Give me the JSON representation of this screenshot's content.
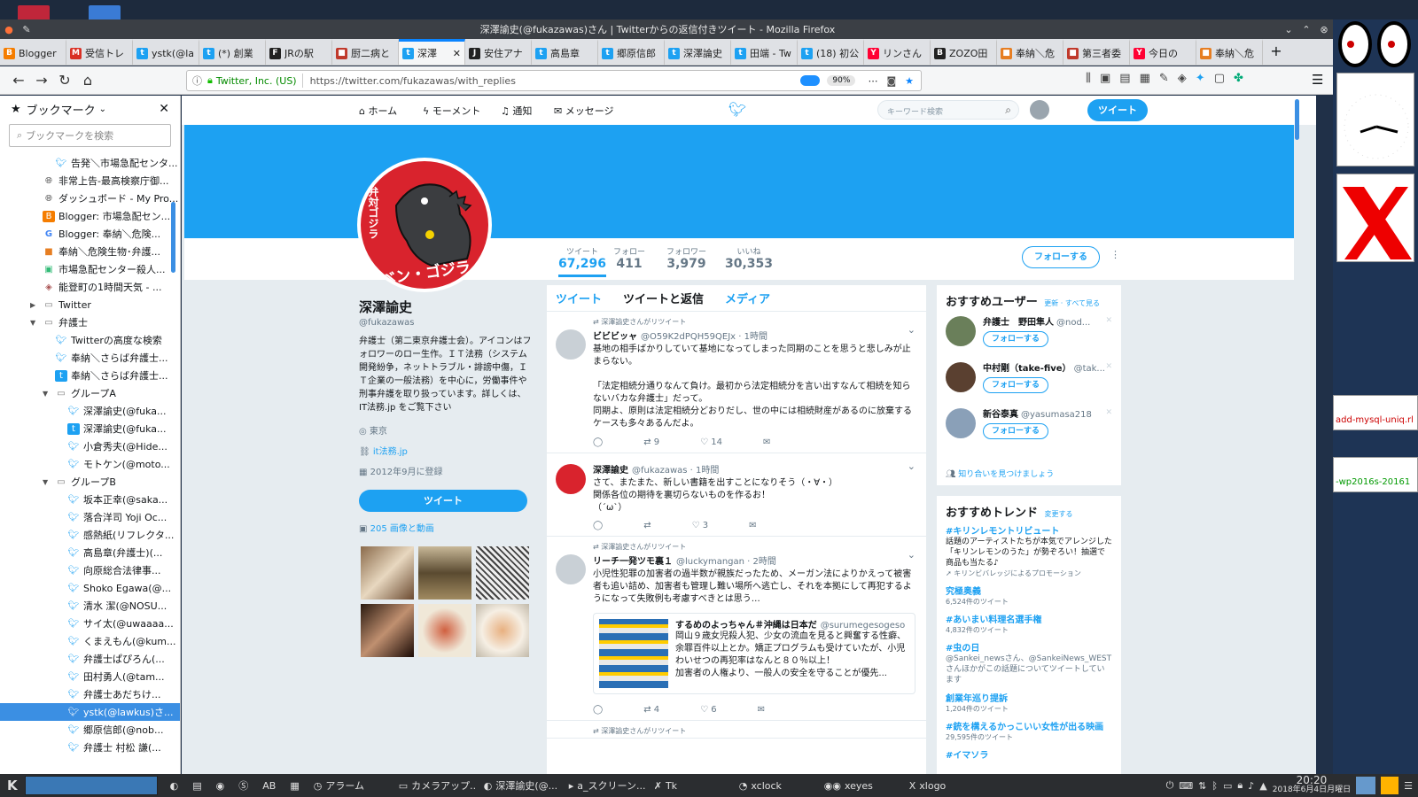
{
  "window_title": "深澤諭史(@fukazawas)さん | Twitterからの返信付きツイート - Mozilla Firefox",
  "tabs": [
    {
      "label": "Blogger",
      "color": "#f57d00",
      "glyph": "B"
    },
    {
      "label": "受信トレ",
      "color": "#d93025",
      "glyph": "M"
    },
    {
      "label": "ystk(@la",
      "color": "#1da1f2",
      "glyph": "t"
    },
    {
      "label": "(*) 創業",
      "color": "#1da1f2",
      "glyph": "t"
    },
    {
      "label": "JRの駅",
      "color": "#222222",
      "glyph": "F"
    },
    {
      "label": "厨二病と",
      "color": "#c0392b",
      "glyph": "■"
    },
    {
      "label": "深澤",
      "color": "#1da1f2",
      "glyph": "t",
      "active": true
    },
    {
      "label": "安住アナ",
      "color": "#222222",
      "glyph": "J"
    },
    {
      "label": "高島章",
      "color": "#1da1f2",
      "glyph": "t"
    },
    {
      "label": "郷原信郎",
      "color": "#1da1f2",
      "glyph": "t"
    },
    {
      "label": "深澤論史",
      "color": "#1da1f2",
      "glyph": "t"
    },
    {
      "label": "田端 - Tw",
      "color": "#1da1f2",
      "glyph": "t"
    },
    {
      "label": "(18) 初公",
      "color": "#1da1f2",
      "glyph": "t"
    },
    {
      "label": "リンさん",
      "color": "#ff0033",
      "glyph": "Y"
    },
    {
      "label": "ZOZO田",
      "color": "#222222",
      "glyph": "B"
    },
    {
      "label": "奉納＼危",
      "color": "#e67e22",
      "glyph": "■"
    },
    {
      "label": "第三者委",
      "color": "#c0392b",
      "glyph": "■"
    },
    {
      "label": "今日の",
      "color": "#ff0033",
      "glyph": "Y"
    },
    {
      "label": "奉納＼危",
      "color": "#e67e22",
      "glyph": "■"
    }
  ],
  "urlbar": {
    "identity": "Twitter, Inc. (US)",
    "url": "https://twitter.com/fukazawas/with_replies",
    "zoom": "90%"
  },
  "sidebar": {
    "title": "ブックマーク",
    "search_placeholder": "ブックマークを検索",
    "items": [
      {
        "label": "告発＼市場急配センタ...",
        "indent": 62,
        "icon": "tw"
      },
      {
        "label": "非常上告-最高検察庁御...",
        "indent": 48,
        "icon": "globe"
      },
      {
        "label": "ダッシュボード - My Pro...",
        "indent": 48,
        "icon": "globe"
      },
      {
        "label": "Blogger: 市場急配セン...",
        "indent": 48,
        "icon": "blogger"
      },
      {
        "label": "Blogger: 奉納＼危険...",
        "indent": 48,
        "icon": "g"
      },
      {
        "label": "奉納＼危険生物･弁護...",
        "indent": 48,
        "icon": "red"
      },
      {
        "label": "市場急配センター殺人...",
        "indent": 48,
        "icon": "img"
      },
      {
        "label": "能登町の1時間天気 - ...",
        "indent": 48,
        "icon": "cube"
      },
      {
        "label": "Twitter",
        "indent": 48,
        "icon": "folder",
        "arrow": "▶"
      },
      {
        "label": "弁護士",
        "indent": 48,
        "icon": "folder",
        "arrow": "▼"
      },
      {
        "label": "Twitterの高度な検索",
        "indent": 62,
        "icon": "tw"
      },
      {
        "label": "奉納＼さらば弁護士...",
        "indent": 62,
        "icon": "tw"
      },
      {
        "label": "奉納＼さらば弁護士...",
        "indent": 62,
        "icon": "tsq"
      },
      {
        "label": "グループA",
        "indent": 62,
        "icon": "folder",
        "arrow": "▼"
      },
      {
        "label": "深澤諭史(@fuka...",
        "indent": 76,
        "icon": "tw"
      },
      {
        "label": "深澤諭史(@fuka...",
        "indent": 76,
        "icon": "tsq"
      },
      {
        "label": "小倉秀夫(@Hide...",
        "indent": 76,
        "icon": "tw"
      },
      {
        "label": "モトケン(@moto...",
        "indent": 76,
        "icon": "tw"
      },
      {
        "label": "グループB",
        "indent": 62,
        "icon": "folder",
        "arrow": "▼"
      },
      {
        "label": "坂本正幸(@saka...",
        "indent": 76,
        "icon": "tw"
      },
      {
        "label": "落合洋司 Yoji Oc...",
        "indent": 76,
        "icon": "tw"
      },
      {
        "label": "感熱紙(リフレクタ...",
        "indent": 76,
        "icon": "tw"
      },
      {
        "label": "高島章(弁護士)(...",
        "indent": 76,
        "icon": "tw"
      },
      {
        "label": "向原総合法律事...",
        "indent": 76,
        "icon": "tw"
      },
      {
        "label": "Shoko Egawa(@...",
        "indent": 76,
        "icon": "tw"
      },
      {
        "label": "清水 潔(@NOSU...",
        "indent": 76,
        "icon": "tw"
      },
      {
        "label": "サイ太(@uwaaaa...",
        "indent": 76,
        "icon": "tw"
      },
      {
        "label": "くまえもん(@kum...",
        "indent": 76,
        "icon": "tw"
      },
      {
        "label": "弁護士ぱぴろん(...",
        "indent": 76,
        "icon": "tw"
      },
      {
        "label": "田村勇人(@tam...",
        "indent": 76,
        "icon": "tw"
      },
      {
        "label": "弁護士あだちけ...",
        "indent": 76,
        "icon": "tw"
      },
      {
        "label": "ystk(@lawkus)さ...",
        "indent": 76,
        "icon": "tw",
        "selected": true
      },
      {
        "label": "郷原信郎(@nob...",
        "indent": 76,
        "icon": "tw"
      },
      {
        "label": "弁護士 村松 謙(...",
        "indent": 76,
        "icon": "tw"
      }
    ]
  },
  "twitter": {
    "nav": {
      "home": "ホーム",
      "moments": "モーメント",
      "notifications": "通知",
      "messages": "メッセージ",
      "search_placeholder": "キーワード検索",
      "tweet_button": "ツイート"
    },
    "stats": [
      {
        "key": "ツイート",
        "value": "67,296",
        "active": true
      },
      {
        "key": "フォロー",
        "value": "411"
      },
      {
        "key": "フォロワー",
        "value": "3,979"
      },
      {
        "key": "いいね",
        "value": "30,353"
      }
    ],
    "follow_button": "フォローする",
    "avatar_text_1": "弁対ゴジラ",
    "avatar_text_2": "ベン・ゴジラ",
    "profile": {
      "name": "深澤諭史",
      "handle": "@fukazawas",
      "bio": "弁護士（第二東京弁護士会）。アイコンはフォロワーのロー生作。ＩＴ法務（システム開発紛争，ネットトラブル・誹謗中傷，ＩＴ企業の一般法務）を中心に，労働事件や刑事弁護を取り扱っています。詳しくは、IT法務.jp をご覧下さい",
      "location": "東京",
      "website": "it法務.jp",
      "joined": "2012年9月に登録",
      "tweet_button": "ツイート",
      "media_label": "205 画像と動画"
    },
    "timeline_tabs": [
      "ツイート",
      "ツイートと返信",
      "メディア"
    ],
    "tweets": [
      {
        "context": "深澤諭史さんがリツイート",
        "name": "ビビビッャ",
        "handle": "@O59K2dPQH59QEJx",
        "time": "1時間",
        "text": "基地の相手ばかりしていて基地になってしまった同期のことを思うと悲しみが止まらない。\n\n「法定相続分通りなんて負け。最初から法定相続分を言い出すなんて相続を知らないバカな弁護士」だって。\n同期よ、原則は法定相続分どおりだし、世の中には相続財産があるのに放棄するケースも多々あるんだよ。",
        "retweets": "9",
        "likes": "14"
      },
      {
        "context": "",
        "name": "深澤諭史",
        "handle": "@fukazawas",
        "time": "1時間",
        "text": "さて、またまた、新しい書籍を出すことになりそう（・∀・）\n関係各位の期待を裏切らないものを作るお！\n（´ω`）",
        "retweets": "",
        "likes": "3"
      },
      {
        "context": "深澤諭史さんがリツイート",
        "name": "リーチ一発ツモ裏１",
        "handle": "@luckymangan",
        "time": "2時間",
        "text": "小児性犯罪の加害者の過半数が親族だったため、メーガン法によりかえって被害者も追い詰め、加害者も管理し難い場所へ逃亡し、それを本拠にして再犯するようになって失敗例も考慮すべきとは思う…",
        "quote_name": "するめのよっちゃん＃沖縄は日本だ",
        "quote_handle": "@surumegesogeso",
        "quote_text": "岡山９歳女児殺人犯、少女の流血を見ると興奮する性癖、余罪百件以上とか。矯正プログラムも受けていたが、小児わいせつの再犯率はなんと８０％以上！\n加害者の人権より、一般人の安全を守ることが優先...",
        "retweets": "4",
        "likes": "6"
      },
      {
        "context": "深澤諭史さんがリツイート"
      }
    ],
    "recommend": {
      "title": "おすすめユーザー",
      "links": "更新 · すべて見る",
      "users": [
        {
          "name": "弁護士　野田隼人",
          "handle": "@nod...",
          "button": "フォローする"
        },
        {
          "name": "中村剛（take-five）",
          "handle": "@tak...",
          "button": "フォローする"
        },
        {
          "name": "新谷泰真",
          "handle": "@yasumasa218",
          "button": "フォローする"
        }
      ],
      "find_friends": "知り合いを見つけましょう"
    },
    "trends": {
      "title": "おすすめトレンド",
      "change": "変更する",
      "items": [
        {
          "name": "#キリンレモントリビュート",
          "desc": "話題のアーティストたちが本気でアレンジした「キリンレモンのうた」が勢ぞろい！抽選で商品も当たる♪",
          "promo": "キリンビバレッジによるプロモーション"
        },
        {
          "name": "究極奥義",
          "count": "6,524件のツイート"
        },
        {
          "name": "#あいまい料理名選手権",
          "count": "4,832件のツイート"
        },
        {
          "name": "#虫の日",
          "desc": "@Sankei_newsさん、@SankeiNews_WESTさんほかがこの話題についてツイートしています"
        },
        {
          "name": "創業年巡り提訴",
          "count": "1,204件のツイート"
        },
        {
          "name": "#銃を構えるかっこいい女性が出る映画",
          "count": "29,595件のツイート"
        },
        {
          "name": "#イマソラ",
          "count": ""
        }
      ]
    }
  },
  "right_widgets": {
    "snippet1": "add-mysql-uniq.rl",
    "snippet2": "-wp2016s-20161"
  },
  "taskbar": {
    "items": [
      "アラーム",
      "カメラアップ...",
      "深澤諭史(@...",
      "a_スクリーン...",
      "Tk",
      "xclock",
      "xeyes",
      "xlogo"
    ],
    "time": "20:20",
    "date": "2018年6月4日月曜日"
  }
}
